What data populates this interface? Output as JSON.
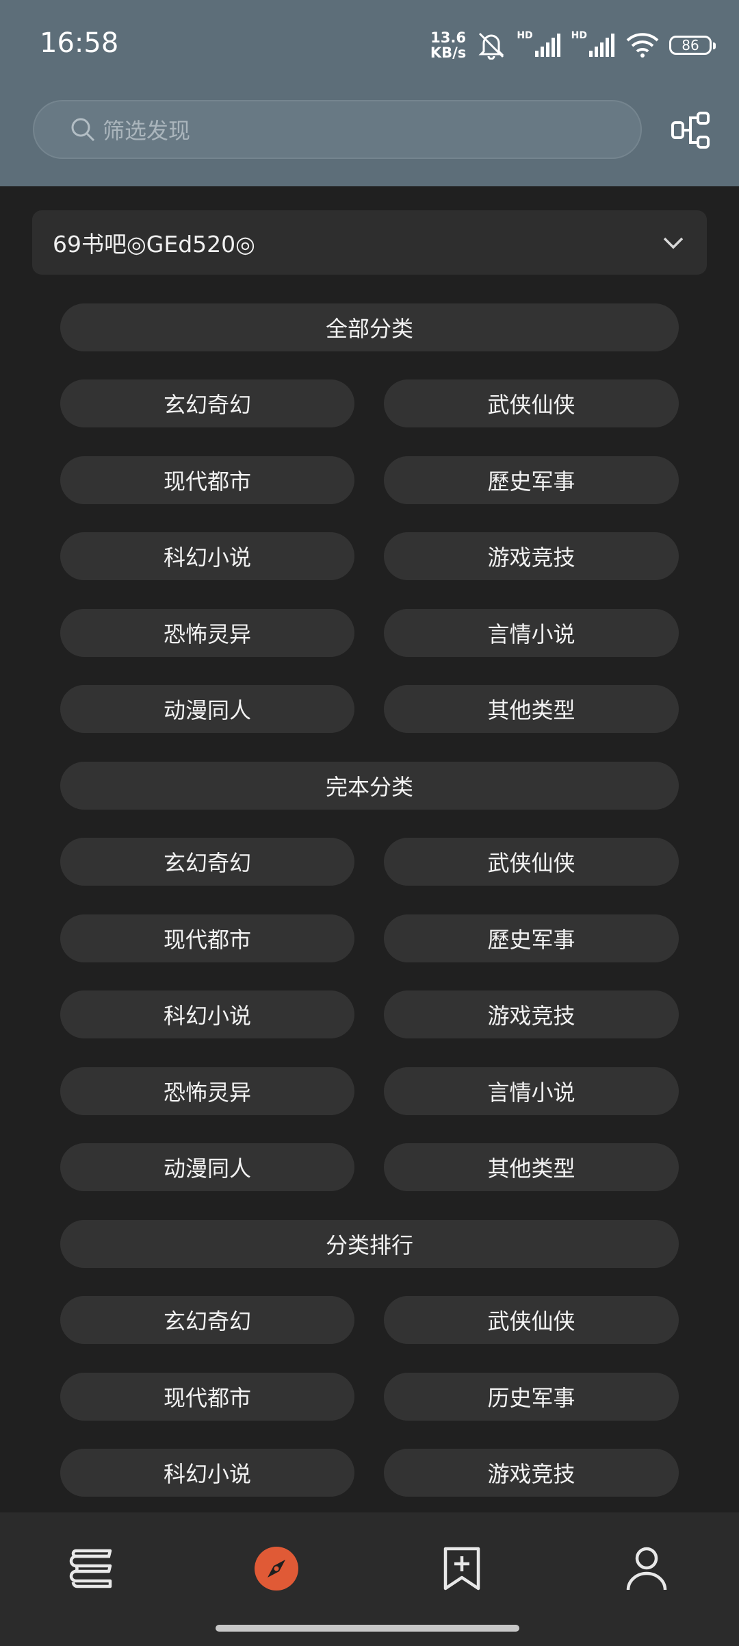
{
  "status_bar": {
    "time": "16:58",
    "net_speed_value": "13.6",
    "net_speed_unit": "KB/s",
    "hd1": "HD",
    "hd2": "HD",
    "battery": "86"
  },
  "search": {
    "placeholder": "筛选发现"
  },
  "source": {
    "selected": "69书吧◎GEd520◎"
  },
  "sections": [
    {
      "title": "全部分类",
      "items": [
        "玄幻奇幻",
        "武侠仙侠",
        "现代都市",
        "歷史军事",
        "科幻小说",
        "游戏竞技",
        "恐怖灵异",
        "言情小说",
        "动漫同人",
        "其他类型"
      ]
    },
    {
      "title": "完本分类",
      "items": [
        "玄幻奇幻",
        "武侠仙侠",
        "现代都市",
        "歷史军事",
        "科幻小说",
        "游戏竞技",
        "恐怖灵异",
        "言情小说",
        "动漫同人",
        "其他类型"
      ]
    },
    {
      "title": "分类排行",
      "items": [
        "玄幻奇幻",
        "武侠仙侠",
        "现代都市",
        "历史军事",
        "科幻小说",
        "游戏竞技"
      ]
    }
  ],
  "bottom_nav": [
    {
      "icon": "bookshelf-icon"
    },
    {
      "icon": "compass-icon",
      "active_color": "#e05a36"
    },
    {
      "icon": "bookmark-add-icon"
    },
    {
      "icon": "person-icon"
    }
  ]
}
